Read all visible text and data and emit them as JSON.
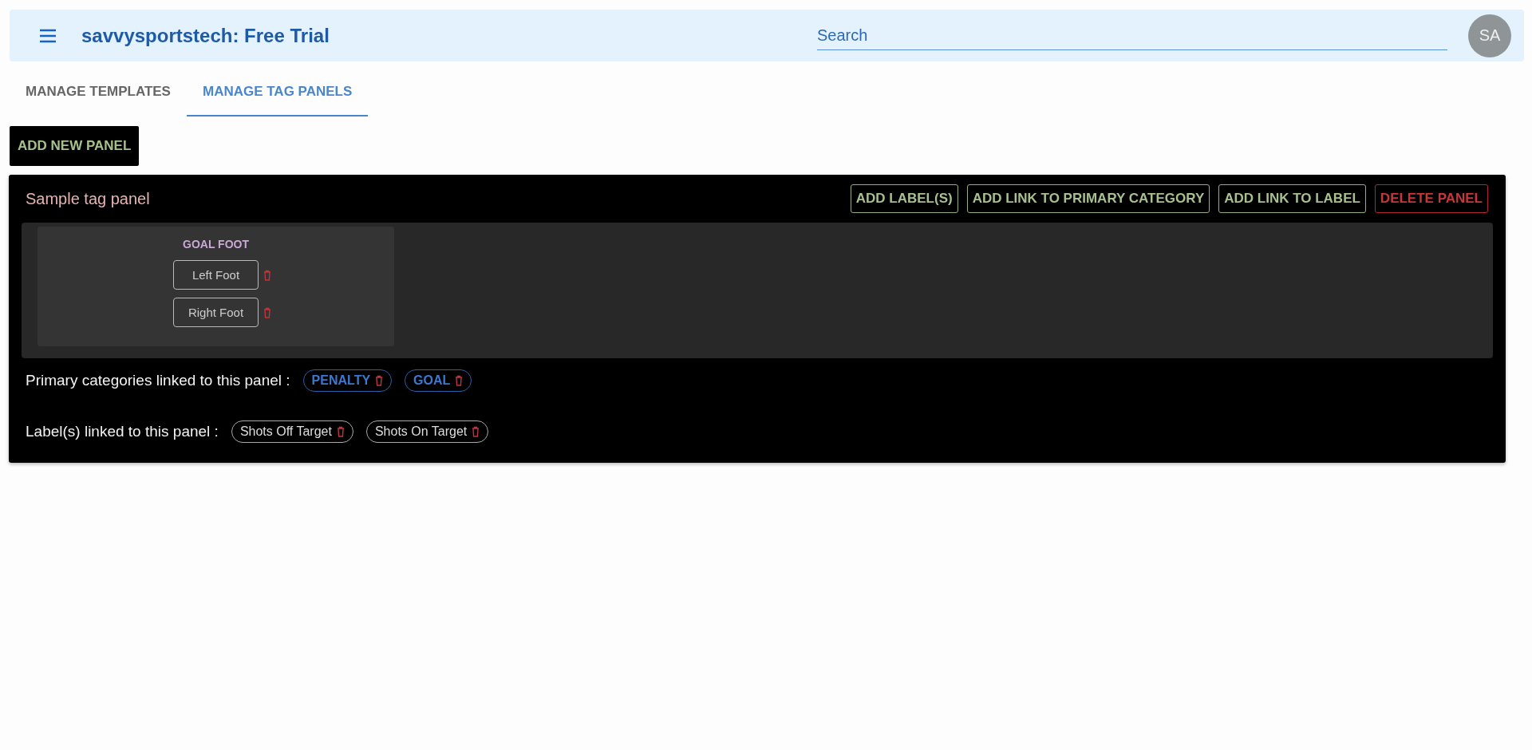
{
  "app_bar": {
    "title": "savvysportstech: Free Trial",
    "search": {
      "placeholder": "Search"
    },
    "avatar": "SA"
  },
  "tabs": [
    {
      "label": "MANAGE TEMPLATES",
      "selected": false
    },
    {
      "label": "MANAGE TAG PANELS",
      "selected": true
    }
  ],
  "add_button": "ADD NEW PANEL",
  "panel": {
    "title": "Sample tag panel",
    "actions": [
      {
        "label": "ADD LABEL(S)",
        "kind": "action"
      },
      {
        "label": "ADD LINK TO PRIMARY CATEGORY",
        "kind": "action"
      },
      {
        "label": "ADD LINK TO LABEL",
        "kind": "action"
      },
      {
        "label": "DELETE PANEL",
        "kind": "danger"
      }
    ],
    "groups": [
      {
        "title": "GOAL FOOT",
        "items": [
          "Left Foot",
          "Right Foot"
        ]
      }
    ],
    "categories": {
      "label": "Primary categories linked to this panel :",
      "chips": [
        "PENALTY",
        "GOAL"
      ]
    },
    "labels": {
      "label": "Label(s) linked to this panel :",
      "chips": [
        "Shots Off Target",
        "Shots On Target"
      ]
    }
  }
}
